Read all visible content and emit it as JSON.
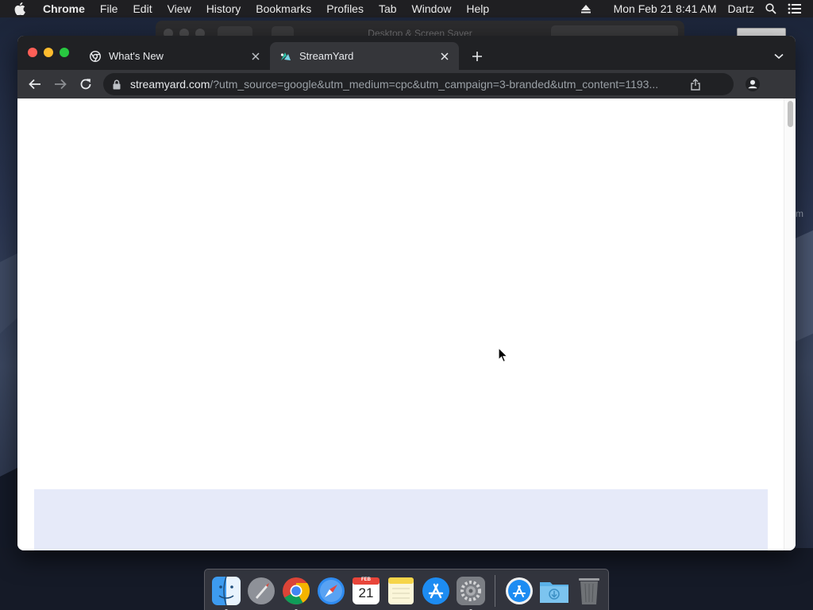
{
  "menubar": {
    "app_name": "Chrome",
    "items": [
      "File",
      "Edit",
      "View",
      "History",
      "Bookmarks",
      "Profiles",
      "Tab",
      "Window",
      "Help"
    ],
    "datetime": "Mon Feb 21  8:41 AM",
    "user": "Dartz"
  },
  "background_window": {
    "title": "Desktop & Screen Saver"
  },
  "desktop_side_text": "m",
  "browser": {
    "tabs": [
      {
        "title": "What's New",
        "active": false,
        "favicon": "chrome-icon"
      },
      {
        "title": "StreamYard",
        "active": true,
        "favicon": "streamyard-icon"
      }
    ],
    "url_host": "streamyard.com",
    "url_rest": "/?utm_source=google&utm_medium=cpc&utm_campaign=3-branded&utm_content=1193..."
  },
  "dock": {
    "apps": [
      "Finder",
      "Launchpad",
      "Google Chrome",
      "Safari",
      "Calendar",
      "Notes",
      "App Store",
      "System Preferences",
      "App Store",
      "Downloads",
      "Trash"
    ],
    "calendar_month": "FEB",
    "calendar_day": "21"
  },
  "colors": {
    "tabstrip": "#202124",
    "toolbar": "#35363a",
    "hero_band": "#e6eaf9"
  }
}
